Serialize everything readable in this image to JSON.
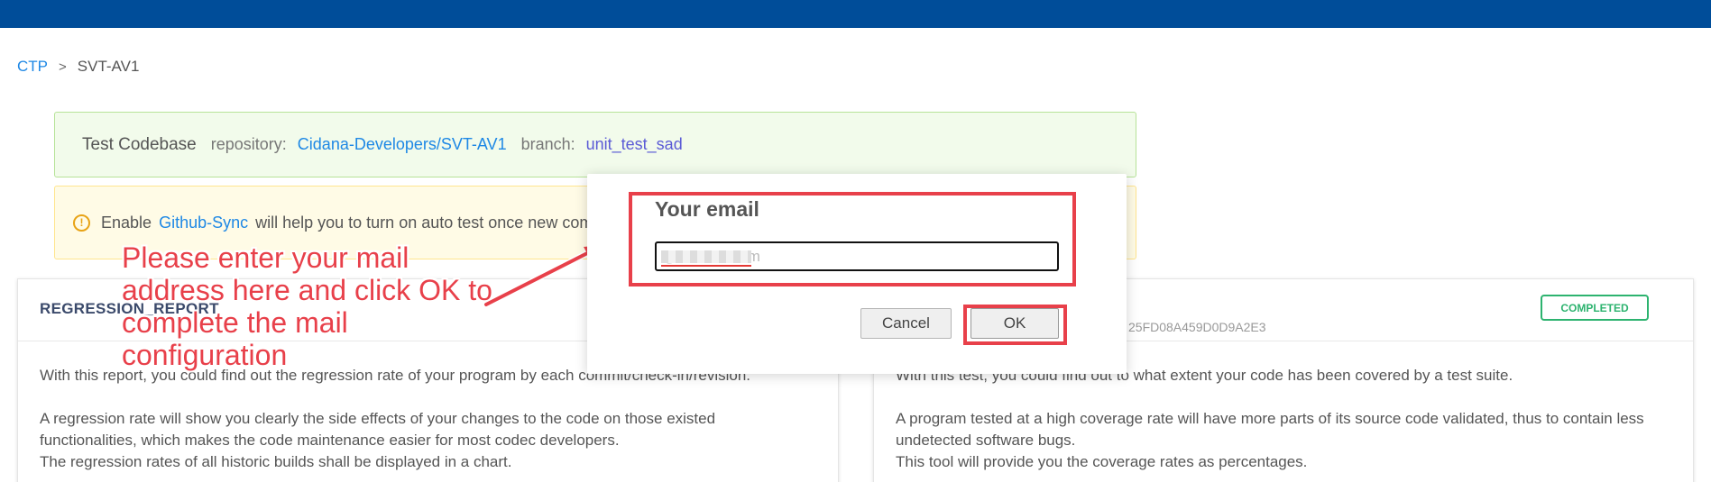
{
  "breadcrumb": {
    "root": "CTP",
    "separator": ">",
    "current": "SVT-AV1"
  },
  "codebase": {
    "title": "Test Codebase",
    "repo_label": "repository:",
    "repo_value": "Cidana-Developers/SVT-AV1",
    "branch_label": "branch:",
    "branch_value": "unit_test_sad"
  },
  "notice": {
    "icon": "info-circle-icon",
    "prefix": "Enable",
    "link": "Github-Sync",
    "text": "will help you to turn on auto test once new comm"
  },
  "regression_card": {
    "title": "REGRESSION_REPORT",
    "para1": "With this report, you could find out the regression rate of your program by each commit/check-in/revision.",
    "para2_line1": "A regression rate will show you clearly the side effects of your changes to the code on those existed",
    "para2_line2": "functionalities, which makes the code maintenance easier for most codec developers.",
    "para3": "The regression rates of all historic builds shall be displayed in a chart."
  },
  "coverage_card": {
    "hash": "25FD08A459D0D9A2E3",
    "status": "COMPLETED",
    "para1": "With this test, you could find out to what extent your code has been covered by a test suite.",
    "para2_line1": "A program tested at a high coverage rate will have more parts of its source code validated, thus to contain less",
    "para2_line2": "undetected software bugs.",
    "para3": "This tool will provide you the coverage rates as percentages."
  },
  "dialog": {
    "title": "Your email",
    "email_value": "@outlook.com",
    "cancel": "Cancel",
    "ok": "OK"
  },
  "annotation": {
    "text": "Please enter your mail address here and click OK to complete the mail configuration"
  },
  "colors": {
    "topbar": "#004d99",
    "link": "#1e88e5",
    "highlight": "#e8404a",
    "success": "#2db36f"
  }
}
